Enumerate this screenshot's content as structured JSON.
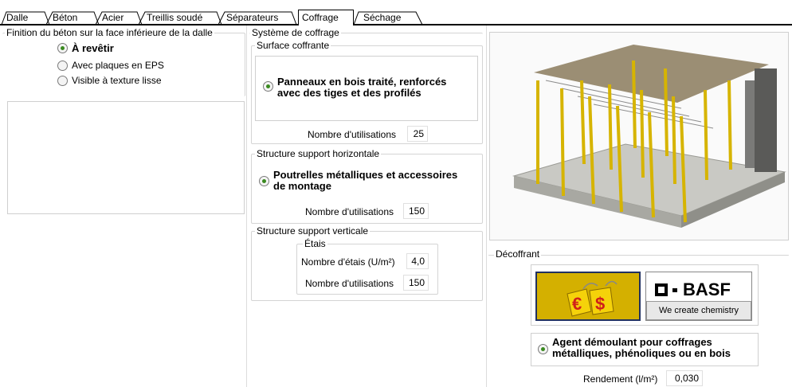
{
  "tabs": [
    "Dalle",
    "Béton",
    "Acier",
    "Treillis soudé",
    "Séparateurs",
    "Coffrage",
    "Séchage"
  ],
  "active_tab": "Coffrage",
  "finition": {
    "title": "Finition du béton sur la face inférieure de la dalle",
    "options": [
      {
        "label": "À revêtir",
        "selected": true
      },
      {
        "label": "Avec plaques en EPS",
        "selected": false
      },
      {
        "label": "Visible à texture lisse",
        "selected": false
      }
    ]
  },
  "systeme": {
    "title": "Système de coffrage",
    "surface": {
      "title": "Surface coffrante",
      "option": "Panneaux en bois traité, renforcés avec des tiges et des profilés",
      "option_line1": "Panneaux en bois traité, renforcés",
      "option_line2": "avec des tiges et des profilés",
      "uses_label": "Nombre d'utilisations",
      "uses_value": "25"
    },
    "horizontal": {
      "title": "Structure support horizontale",
      "option_line1": "Poutrelles métalliques et accessoires",
      "option_line2": "de montage",
      "uses_label": "Nombre d'utilisations",
      "uses_value": "150"
    },
    "vertical": {
      "title": "Structure support verticale",
      "etais_title": "Étais",
      "count_label": "Nombre d'étais (U/m²)",
      "count_value": "4,0",
      "uses_label": "Nombre d'utilisations",
      "uses_value": "150"
    }
  },
  "decoffrant": {
    "title": "Décoffrant",
    "brand_name": "BASF",
    "brand_tagline": "We create chemistry",
    "option_line1": "Agent démoulant pour coffrages",
    "option_line2": "métalliques, phénoliques ou en bois",
    "rendement_label": "Rendement (l/m²)",
    "rendement_value": "0,030"
  },
  "colors": {
    "accent_green": "#3a8a20",
    "price_yellow": "#f5d20a",
    "price_red": "#d0201a",
    "price_bg": "#c8a800"
  }
}
